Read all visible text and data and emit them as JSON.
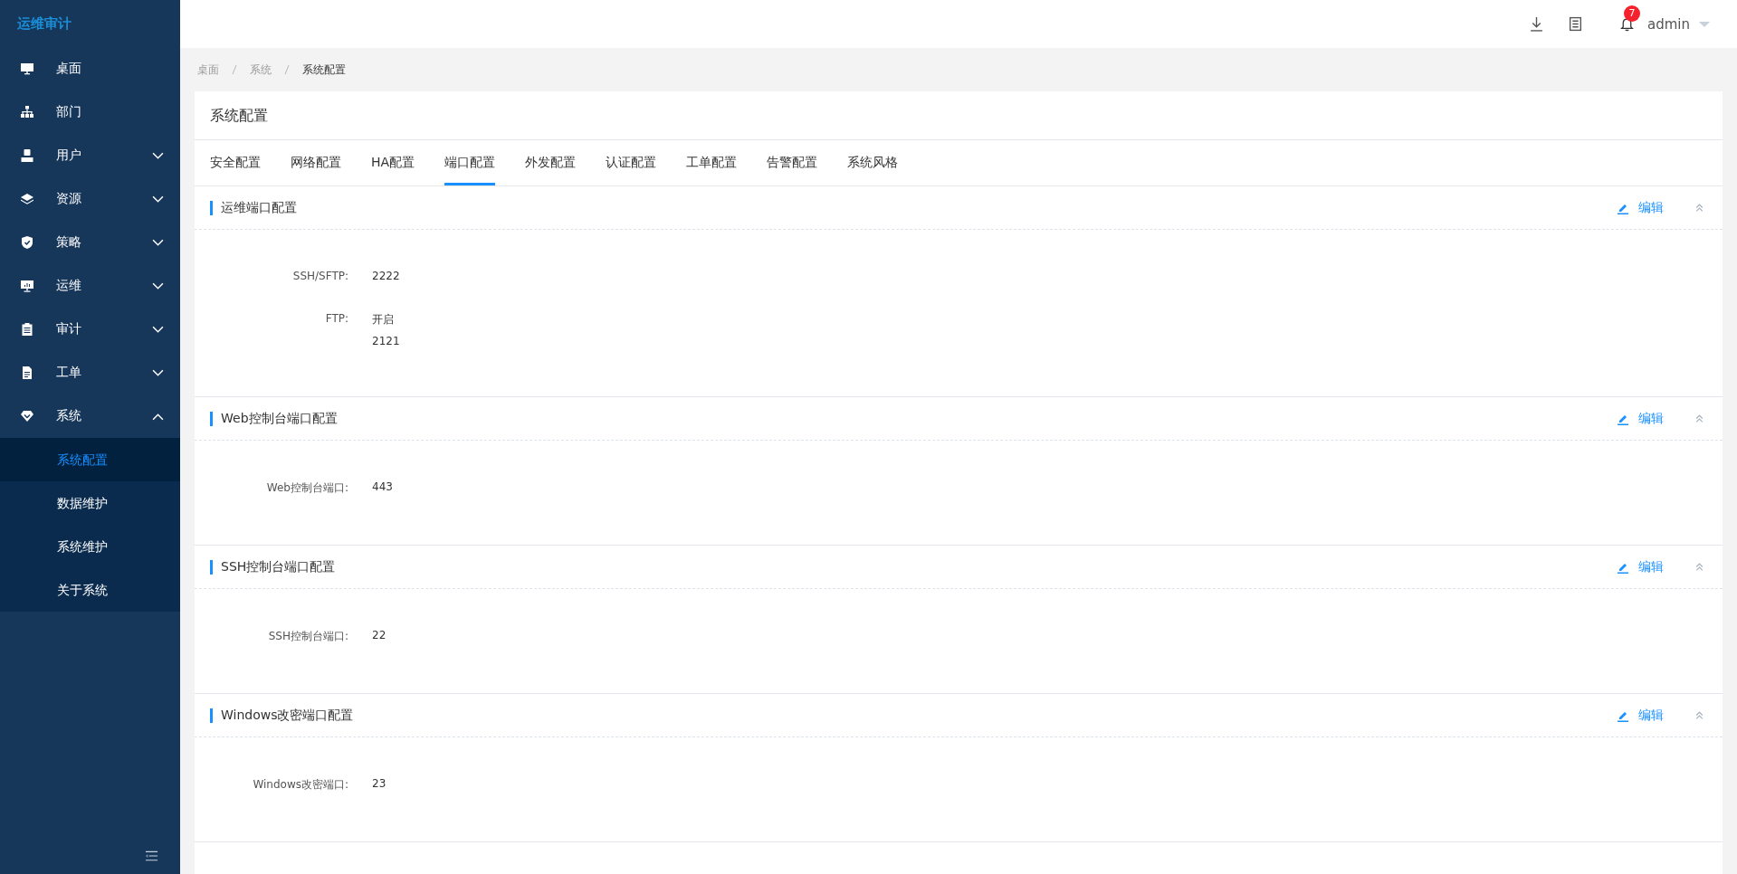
{
  "sidebar": {
    "logo": "运维审计",
    "items": [
      {
        "label": "桌面"
      },
      {
        "label": "部门"
      },
      {
        "label": "用户",
        "expanded": false
      },
      {
        "label": "资源",
        "expanded": false
      },
      {
        "label": "策略",
        "expanded": false
      },
      {
        "label": "运维",
        "expanded": false
      },
      {
        "label": "审计",
        "expanded": false
      },
      {
        "label": "工单",
        "expanded": false
      },
      {
        "label": "系统",
        "expanded": true,
        "children": [
          {
            "label": "系统配置",
            "selected": true
          },
          {
            "label": "数据维护",
            "selected": false
          },
          {
            "label": "系统维护",
            "selected": false
          },
          {
            "label": "关于系统",
            "selected": false
          }
        ]
      }
    ]
  },
  "header": {
    "notification_count": "7",
    "user": "admin"
  },
  "breadcrumb": [
    "桌面",
    "系统",
    "系统配置"
  ],
  "card": {
    "title": "系统配置",
    "tabs": [
      {
        "label": "安全配置",
        "selected": false
      },
      {
        "label": "网络配置",
        "selected": false
      },
      {
        "label": "HA配置",
        "selected": false
      },
      {
        "label": "端口配置",
        "selected": true
      },
      {
        "label": "外发配置",
        "selected": false
      },
      {
        "label": "认证配置",
        "selected": false
      },
      {
        "label": "工单配置",
        "selected": false
      },
      {
        "label": "告警配置",
        "selected": false
      },
      {
        "label": "系统风格",
        "selected": false
      }
    ],
    "sections": [
      {
        "title": "运维端口配置",
        "edit": "编辑",
        "fields": [
          {
            "label": "SSH/SFTP:",
            "values": [
              "2222"
            ]
          },
          {
            "label": "FTP:",
            "values": [
              "开启",
              "2121"
            ]
          }
        ]
      },
      {
        "title": "Web控制台端口配置",
        "edit": "编辑",
        "fields": [
          {
            "label": "Web控制台端口:",
            "values": [
              "443"
            ]
          }
        ]
      },
      {
        "title": "SSH控制台端口配置",
        "edit": "编辑",
        "fields": [
          {
            "label": "SSH控制台端口:",
            "values": [
              "22"
            ]
          }
        ]
      },
      {
        "title": "Windows改密端口配置",
        "edit": "编辑",
        "fields": [
          {
            "label": "Windows改密端口:",
            "values": [
              "23"
            ]
          }
        ]
      }
    ]
  }
}
